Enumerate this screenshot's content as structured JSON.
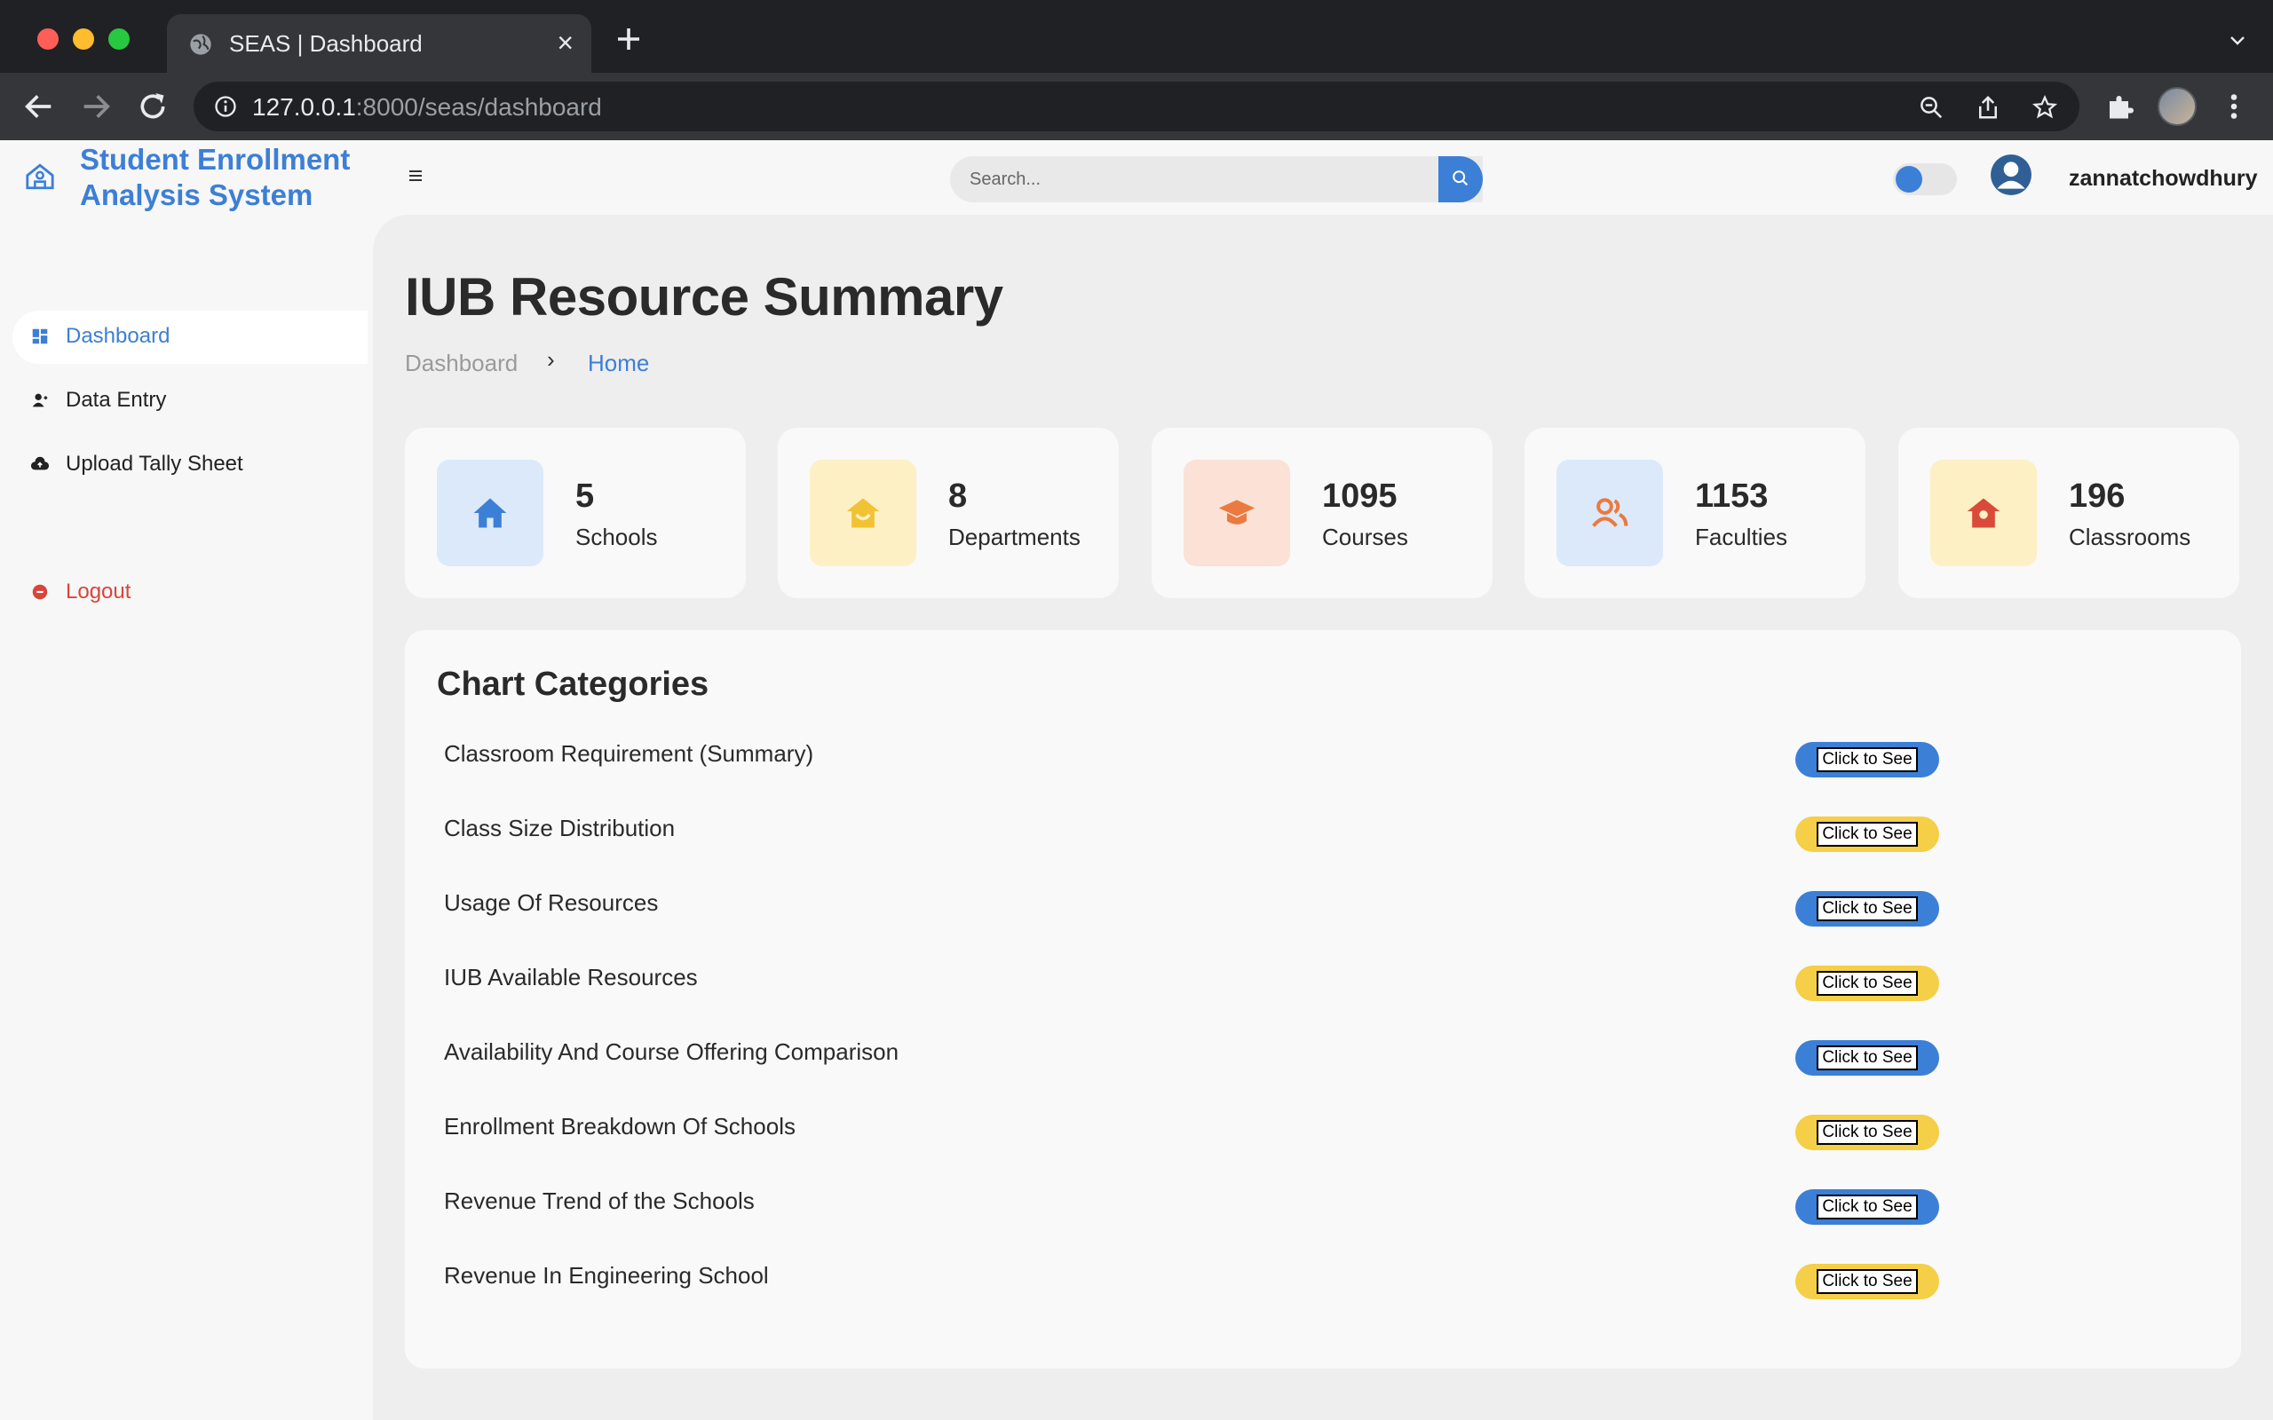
{
  "browser": {
    "tab_title": "SEAS | Dashboard",
    "url_host": "127.0.0.1",
    "url_path": ":8000/seas/dashboard"
  },
  "header": {
    "brand_line1": "Student Enrollment",
    "brand_line2": "Analysis System",
    "search_placeholder": "Search...",
    "username": "zannatchowdhury"
  },
  "sidebar": {
    "items": [
      {
        "label": "Dashboard"
      },
      {
        "label": "Data Entry"
      },
      {
        "label": "Upload Tally Sheet"
      }
    ],
    "logout_label": "Logout"
  },
  "main": {
    "title": "IUB Resource Summary",
    "breadcrumb": {
      "first": "Dashboard",
      "sep": "›",
      "current": "Home"
    },
    "stats": [
      {
        "value": "5",
        "label": "Schools",
        "icon": "home-icon",
        "bg": "#dce9fb",
        "color": "#3c7fd6"
      },
      {
        "value": "8",
        "label": "Departments",
        "icon": "department-icon",
        "bg": "#fdf0c4",
        "color": "#f1c232"
      },
      {
        "value": "1095",
        "label": "Courses",
        "icon": "graduation-cap-icon",
        "bg": "#fbe1d6",
        "color": "#ea7a3f"
      },
      {
        "value": "1153",
        "label": "Faculties",
        "icon": "users-icon",
        "bg": "#dce9fb",
        "color": "#ea7a3f"
      },
      {
        "value": "196",
        "label": "Classrooms",
        "icon": "classroom-icon",
        "bg": "#fdf0c4",
        "color": "#d94a3a"
      }
    ],
    "panel_title": "Chart Categories",
    "button_label": "Click to See",
    "categories": [
      {
        "label": "Classroom Requirement (Summary)",
        "color": "blue"
      },
      {
        "label": "Class Size Distribution",
        "color": "yellow"
      },
      {
        "label": "Usage Of Resources",
        "color": "blue"
      },
      {
        "label": "IUB Available Resources",
        "color": "yellow"
      },
      {
        "label": "Availability And Course Offering Comparison",
        "color": "blue"
      },
      {
        "label": "Enrollment Breakdown Of Schools",
        "color": "yellow"
      },
      {
        "label": "Revenue Trend of the Schools",
        "color": "blue"
      },
      {
        "label": "Revenue In Engineering School",
        "color": "yellow"
      }
    ]
  },
  "colors": {
    "accent": "#3c7fd6",
    "yellow": "#f4cf47",
    "logout": "#d9453a"
  }
}
